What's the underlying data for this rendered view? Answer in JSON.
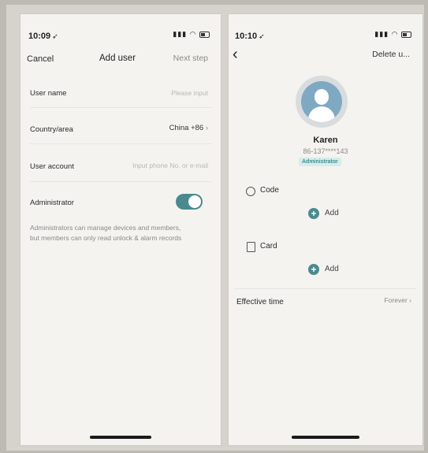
{
  "left": {
    "status_time": "10:09",
    "header": {
      "cancel": "Cancel",
      "title": "Add user",
      "next": "Next step"
    },
    "rows": {
      "user_name": {
        "label": "User name",
        "placeholder": "Please input"
      },
      "country": {
        "label": "Country/area",
        "value": "China +86",
        "chevron": "›"
      },
      "account": {
        "label": "User account",
        "placeholder": "Input phone No. or e-mail"
      },
      "admin": {
        "label": "Administrator",
        "enabled": true
      }
    },
    "note_line1": "Administrators can manage devices and members,",
    "note_line2": "but members can only read unlock & alarm records"
  },
  "right": {
    "status_time": "10:10",
    "header": {
      "back": "‹",
      "delete": "Delete u..."
    },
    "profile": {
      "name": "Karen",
      "phone": "86-137****143",
      "role": "Administrator"
    },
    "sections": {
      "code": {
        "label": "Code",
        "add": "Add"
      },
      "card": {
        "label": "Card",
        "add": "Add"
      }
    },
    "effective": {
      "label": "Effective time",
      "value": "Forever",
      "chevron": "›"
    }
  },
  "colors": {
    "accent": "#4a8a8f",
    "badge_bg": "#d7ecec",
    "screen": "#f4f3f0"
  },
  "icons": [
    "location-arrow-icon",
    "signal-icon",
    "wifi-icon",
    "battery-icon",
    "chevron-right-icon",
    "back-chevron-icon",
    "avatar-icon",
    "code-icon",
    "card-icon",
    "add-icon"
  ]
}
